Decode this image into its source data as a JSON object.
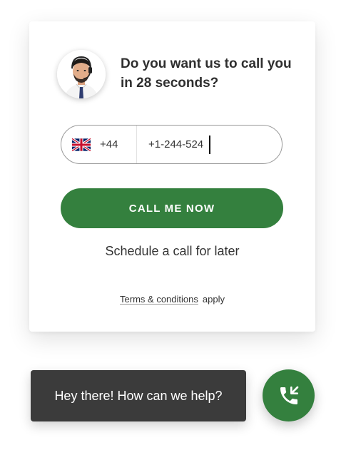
{
  "widget": {
    "question": "Do you want us to call you in 28 seconds?",
    "country": {
      "flag_icon": "uk-flag-icon",
      "code": "+44"
    },
    "phone": {
      "value": "+1-244-524"
    },
    "call_button_label": "CALL ME NOW",
    "schedule_label": "Schedule a call for later",
    "terms_link": "Terms & conditions",
    "terms_suffix": "apply"
  },
  "chat": {
    "message": "Hey there! How can we help?",
    "launcher_icon": "phone-call-icon"
  },
  "colors": {
    "accent": "#34803e",
    "bubble": "#3b3b3b",
    "text": "#333333"
  }
}
